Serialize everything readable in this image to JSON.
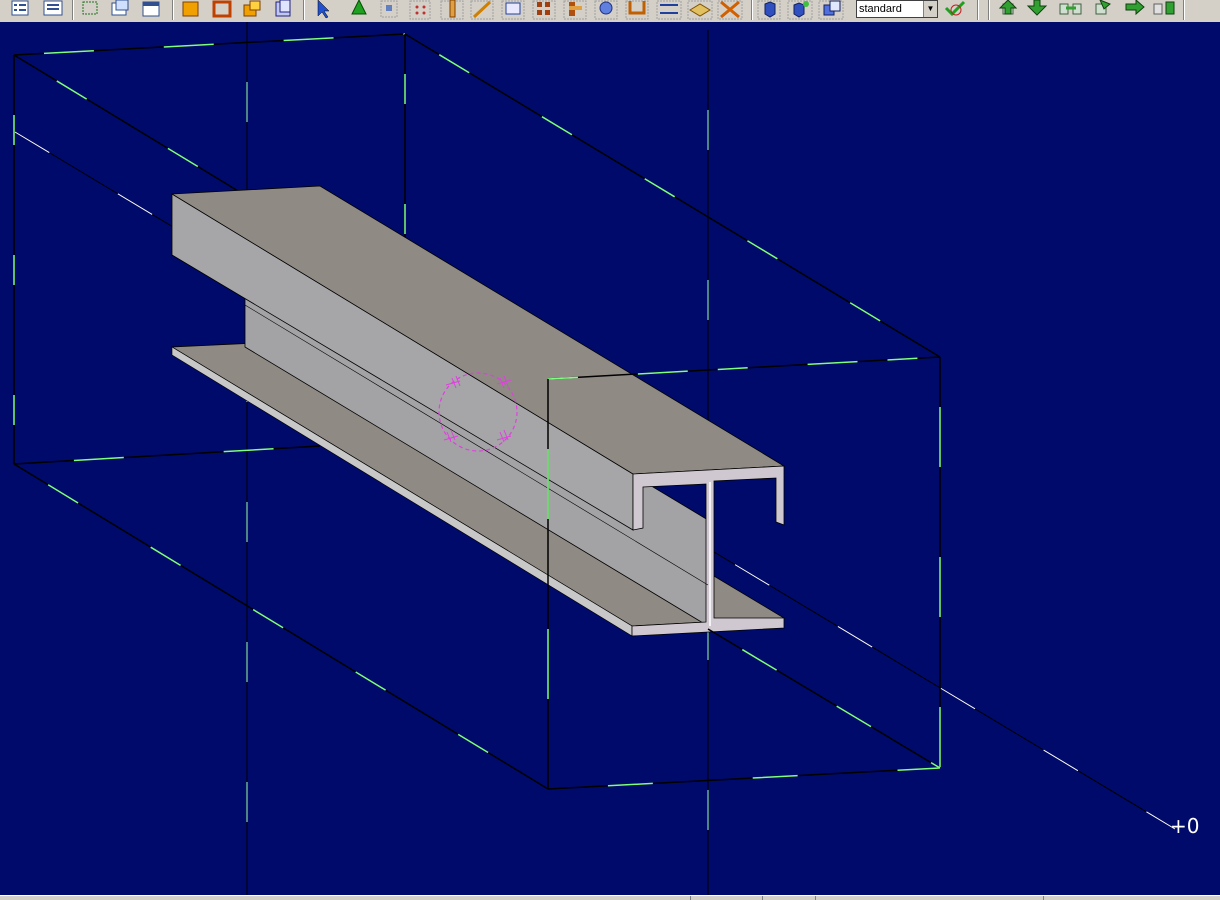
{
  "toolbar": {
    "view_select": {
      "value": "standard"
    },
    "buttons": [
      {
        "name": "properties-button",
        "icon": "properties-icon"
      },
      {
        "name": "list-button",
        "icon": "list-icon"
      },
      {
        "name": "select-area-button",
        "icon": "select-area-icon"
      },
      {
        "name": "copy-view-button",
        "icon": "copy-view-icon"
      },
      {
        "name": "window-button",
        "icon": "window-icon"
      },
      {
        "name": "solid-cube-button",
        "icon": "cube-icon"
      },
      {
        "name": "frame-button",
        "icon": "frame-icon"
      },
      {
        "name": "boolean-button",
        "icon": "boolean-icon"
      },
      {
        "name": "plane-button",
        "icon": "plane-icon"
      },
      {
        "name": "pointer-button",
        "icon": "pointer-icon"
      },
      {
        "name": "cone-button",
        "icon": "cone-icon"
      },
      {
        "name": "snap-button",
        "icon": "snap-icon"
      },
      {
        "name": "grid-button",
        "icon": "grid-icon"
      }
    ]
  },
  "viewport": {
    "background_color": "#000a6a",
    "beam_color": "#a6a6a6",
    "box_edge_color": "#000000",
    "highlight_color": "#7fff7f",
    "axis_label": "+0"
  }
}
